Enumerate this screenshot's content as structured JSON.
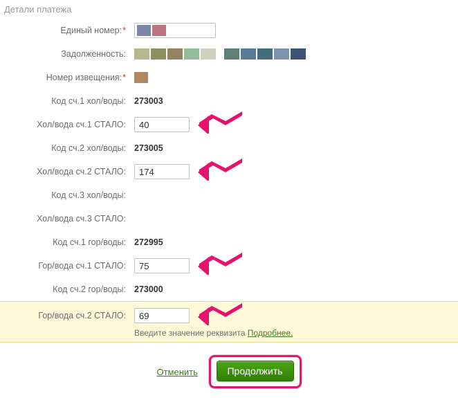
{
  "section_title": "Детали платежа",
  "rows": {
    "unified_number": {
      "label": "Единый номер:",
      "required": true,
      "value": ""
    },
    "debt": {
      "label": "Задолженность:"
    },
    "notice_number": {
      "label": "Номер извещения:",
      "required": true
    },
    "code1_cold": {
      "label": "Код сч.1 хол/воды:",
      "value": "273003"
    },
    "cold1_now": {
      "label": "Хол/вода сч.1 СТАЛО:",
      "value": "40"
    },
    "code2_cold": {
      "label": "Код сч.2 хол/воды:",
      "value": "273005"
    },
    "cold2_now": {
      "label": "Хол/вода сч.2 СТАЛО:",
      "value": "174"
    },
    "code3_cold": {
      "label": "Код сч.3 хол/воды:",
      "value": ""
    },
    "cold3_now": {
      "label": "Хол/вода сч.3 СТАЛО:",
      "value": ""
    },
    "code1_hot": {
      "label": "Код сч.1 гор/воды:",
      "value": "272995"
    },
    "hot1_now": {
      "label": "Гор/вода сч.1 СТАЛО:",
      "value": "75"
    },
    "code2_hot": {
      "label": "Код сч.2 гор/воды:",
      "value": "273000"
    },
    "hot2_now": {
      "label": "Гор/вода сч.2 СТАЛО:",
      "value": "69"
    }
  },
  "hint": {
    "text": "Введите значение реквизита ",
    "link": "Подробнее."
  },
  "footer": {
    "cancel": "Отменить",
    "submit": "Продолжить"
  },
  "redacted_colors": {
    "unified": [
      "#7b86a8",
      "#b97382"
    ],
    "debt": [
      "#b7b68f",
      "#8e8d60",
      "#938160",
      "#95bc98",
      "#d0d0bf",
      "#5e8079",
      "#587c97",
      "#446d7d",
      "#7e92ad",
      "#3f5373"
    ],
    "notice": [
      "#b18961"
    ]
  }
}
